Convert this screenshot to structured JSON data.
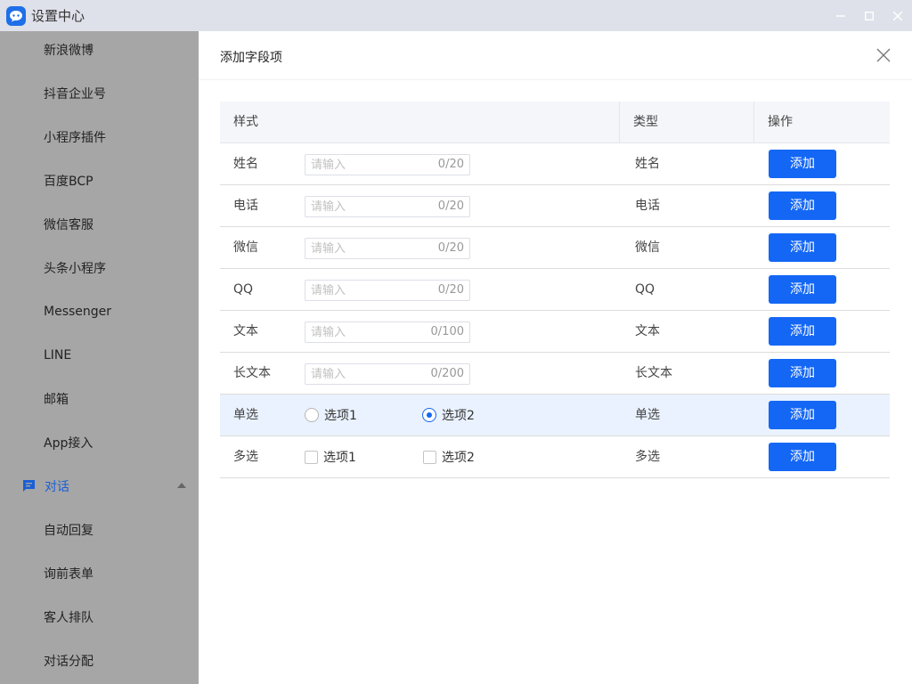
{
  "window": {
    "title": "设置中心"
  },
  "sidebar": {
    "items": [
      {
        "label": "新浪微博"
      },
      {
        "label": "抖音企业号"
      },
      {
        "label": "小程序插件"
      },
      {
        "label": "百度BCP"
      },
      {
        "label": "微信客服"
      },
      {
        "label": "头条小程序"
      },
      {
        "label": "Messenger"
      },
      {
        "label": "LINE"
      },
      {
        "label": "邮箱"
      },
      {
        "label": "App接入"
      },
      {
        "label": "对话",
        "icon": "chat-icon",
        "active_color": "#1a5fd6"
      },
      {
        "label": "自动回复"
      },
      {
        "label": "询前表单"
      },
      {
        "label": "客人排队"
      },
      {
        "label": "对话分配"
      }
    ]
  },
  "dialog": {
    "title": "添加字段项",
    "table": {
      "headers": {
        "style": "样式",
        "type": "类型",
        "action": "操作"
      },
      "rows": [
        {
          "label": "姓名",
          "placeholder": "请输入",
          "counter": "0/20",
          "type": "姓名",
          "action": "添加"
        },
        {
          "label": "电话",
          "placeholder": "请输入",
          "counter": "0/20",
          "type": "电话",
          "action": "添加"
        },
        {
          "label": "微信",
          "placeholder": "请输入",
          "counter": "0/20",
          "type": "微信",
          "action": "添加"
        },
        {
          "label": "QQ",
          "placeholder": "请输入",
          "counter": "0/20",
          "type": "QQ",
          "action": "添加"
        },
        {
          "label": "文本",
          "placeholder": "请输入",
          "counter": "0/100",
          "type": "文本",
          "action": "添加"
        },
        {
          "label": "长文本",
          "placeholder": "请输入",
          "counter": "0/200",
          "type": "长文本",
          "action": "添加"
        },
        {
          "label": "单选",
          "options": [
            "选项1",
            "选项2"
          ],
          "selected": "选项2",
          "type": "单选",
          "action": "添加"
        },
        {
          "label": "多选",
          "options": [
            "选项1",
            "选项2"
          ],
          "type": "多选",
          "action": "添加"
        }
      ]
    }
  },
  "colors": {
    "accent": "#1467f5",
    "sidebar_bg": "#a6a6a6",
    "titlebar_bg": "#dfe1ea",
    "row_highlight": "#eaf2ff"
  }
}
